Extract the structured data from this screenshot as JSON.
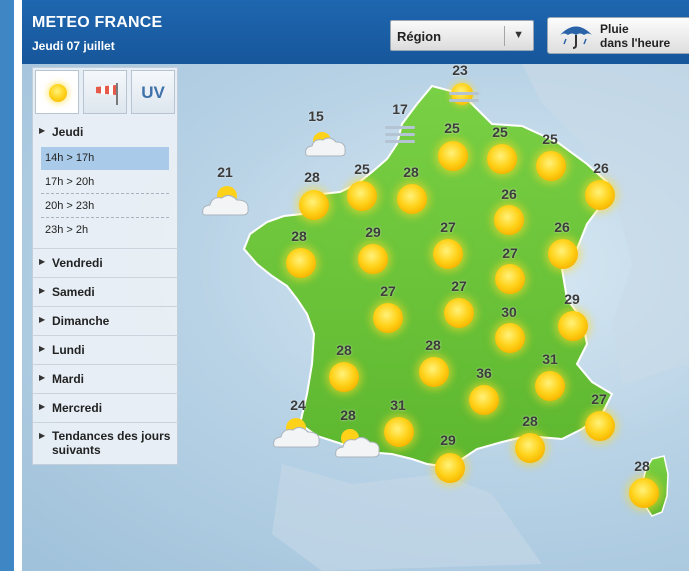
{
  "header": {
    "title": "METEO FRANCE",
    "date": "Jeudi 07 juillet",
    "region_select": "Région",
    "rain_button_line1": "Pluie",
    "rain_button_line2": "dans l'heure"
  },
  "tabs": {
    "uv_label": "UV"
  },
  "days": [
    "Jeudi",
    "Vendredi",
    "Samedi",
    "Dimanche",
    "Lundi",
    "Mardi",
    "Mercredi"
  ],
  "slots": [
    "14h > 17h",
    "17h > 20h",
    "20h > 23h",
    "23h > 2h"
  ],
  "trend_label": "Tendances des jours suivants",
  "temperatures": [
    "23",
    "17",
    "15",
    "21",
    "25",
    "25",
    "25",
    "25",
    "28",
    "28",
    "26",
    "28",
    "29",
    "27",
    "26",
    "26",
    "27",
    "27",
    "27",
    "29",
    "30",
    "28",
    "28",
    "36",
    "31",
    "24",
    "28",
    "31",
    "28",
    "27",
    "29",
    "28"
  ],
  "colors": {
    "header": "#1f67b0",
    "land": "#6cc63a",
    "sea": "#b9d3e6",
    "sun": "#ffd21a",
    "active_slot": "#a9cbe9"
  }
}
